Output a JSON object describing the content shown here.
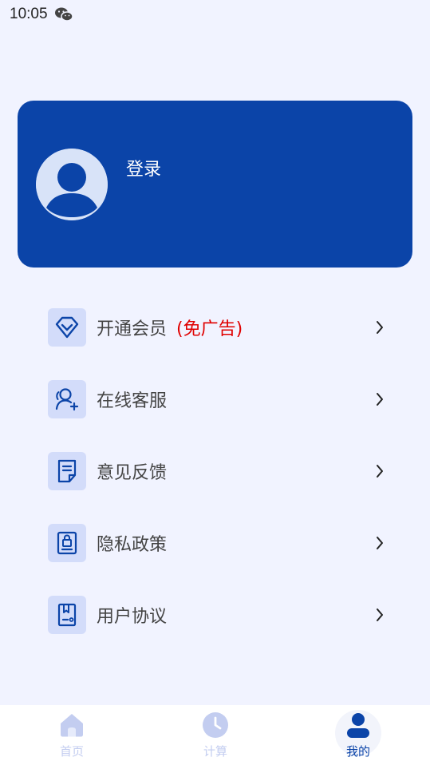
{
  "status": {
    "time": "10:05",
    "app_icon": "wechat-icon"
  },
  "profile": {
    "login_label": "登录",
    "avatar_icon": "user-avatar-icon"
  },
  "menu": [
    {
      "label": "开通会员",
      "tag": "(免广告)",
      "icon": "diamond-icon"
    },
    {
      "label": "在线客服",
      "icon": "add-user-icon"
    },
    {
      "label": "意见反馈",
      "icon": "document-icon"
    },
    {
      "label": "隐私政策",
      "icon": "lock-document-icon"
    },
    {
      "label": "用户协议",
      "icon": "agreement-icon"
    }
  ],
  "tabs": [
    {
      "label": "首页",
      "icon": "home-icon",
      "active": false
    },
    {
      "label": "计算",
      "icon": "clock-icon",
      "active": false
    },
    {
      "label": "我的",
      "icon": "person-icon",
      "active": true
    }
  ],
  "colors": {
    "brand": "#0b44a8",
    "background": "#f1f3ff",
    "icon_bg": "#d3dcfa",
    "tag_red": "#e00000",
    "inactive_tab": "#c3cdf0"
  }
}
